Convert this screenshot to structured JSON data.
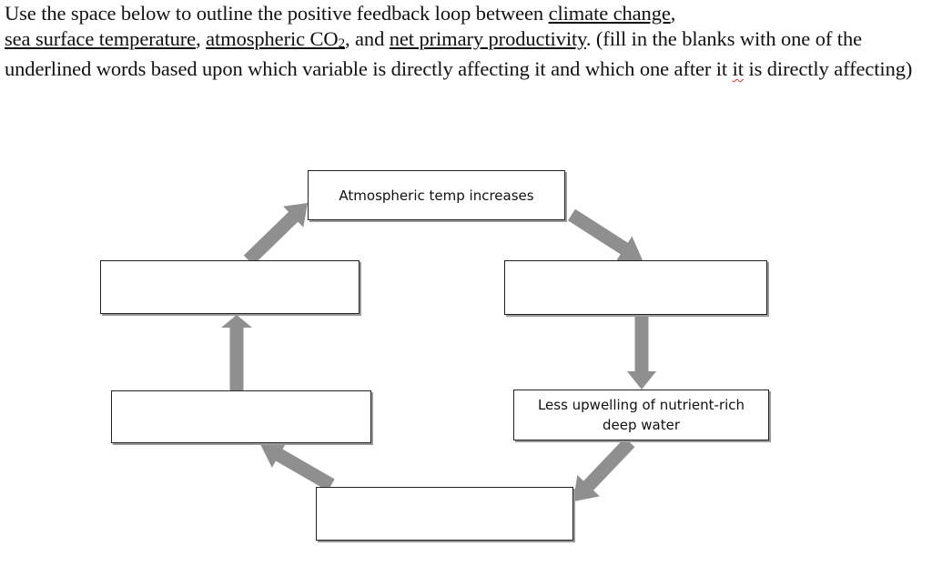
{
  "instructions": {
    "part1": "Use the space below to outline the positive feedback loop between ",
    "term1": "climate change",
    "sep1": ",",
    "term2": "sea surface temperature",
    "sep2": ", ",
    "term3_main": "atmospheric CO",
    "term3_sub": "2",
    "sep3": ", and ",
    "term4": "net primary productivity",
    "part2": ". (fill in the blanks with one of the underlined words based upon which variable is directly affecting it and which one after it ",
    "flagged_word": "it",
    "part3": " is directly affecting)"
  },
  "diagram": {
    "arrow_color": "#8f8f8f",
    "boxes": {
      "top": "Atmospheric temp increases",
      "right_upper": "",
      "right_lower": "Less upwelling of nutrient-rich deep water",
      "bottom": "",
      "left_lower": "",
      "left_upper": ""
    }
  }
}
